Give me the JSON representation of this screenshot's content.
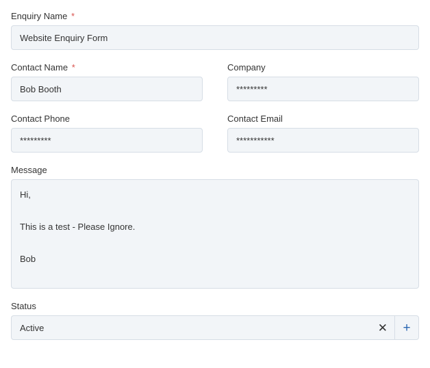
{
  "enquiry_name": {
    "label": "Enquiry Name",
    "required": "*",
    "value": "Website Enquiry Form"
  },
  "contact_name": {
    "label": "Contact Name",
    "required": "*",
    "value": "Bob Booth"
  },
  "company": {
    "label": "Company",
    "value": "*********"
  },
  "contact_phone": {
    "label": "Contact Phone",
    "value": "*********"
  },
  "contact_email": {
    "label": "Contact Email",
    "value": "***********"
  },
  "message": {
    "label": "Message",
    "value": "Hi,\n\nThis is a test - Please Ignore.\n\nBob"
  },
  "status": {
    "label": "Status",
    "value": "Active",
    "clear": "✕",
    "add": "+"
  }
}
